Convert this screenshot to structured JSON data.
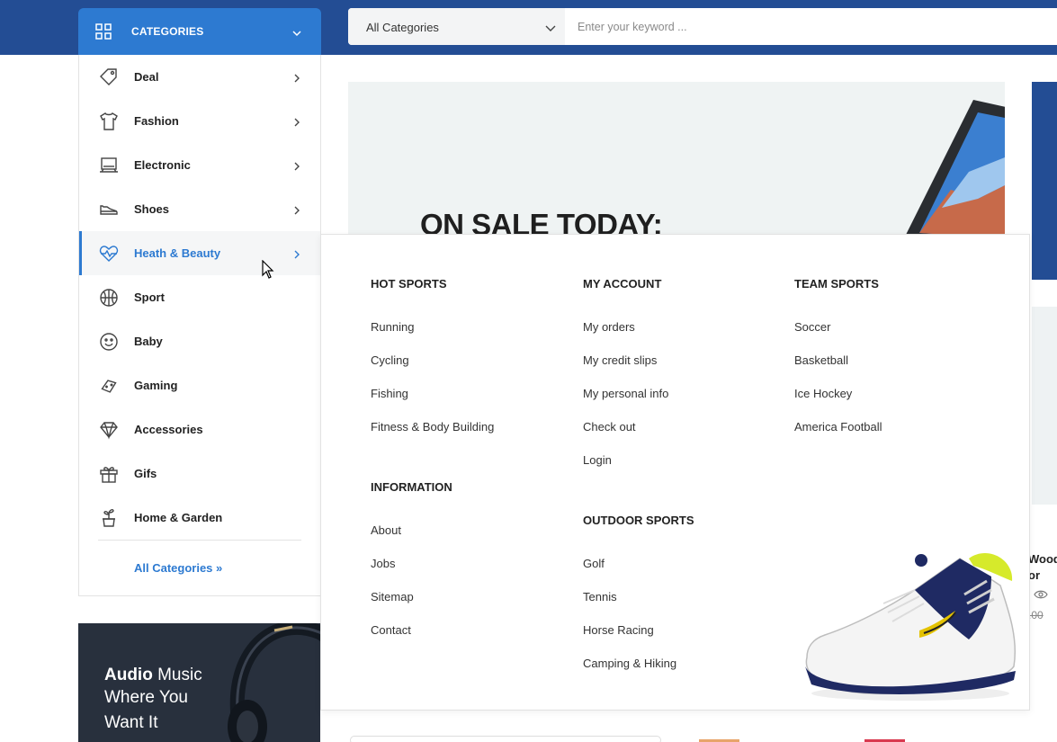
{
  "header": {
    "categories_title": "CATEGORIES",
    "search_category": "All Categories",
    "search_placeholder": "Enter your keyword ..."
  },
  "sidebar": {
    "items": [
      {
        "label": "Deal",
        "icon": "tag-icon"
      },
      {
        "label": "Fashion",
        "icon": "tshirt-icon"
      },
      {
        "label": "Electronic",
        "icon": "laptop-icon"
      },
      {
        "label": "Shoes",
        "icon": "shoe-icon"
      },
      {
        "label": "Heath & Beauty",
        "icon": "heart-pulse-icon",
        "active": true
      },
      {
        "label": "Sport",
        "icon": "basketball-icon"
      },
      {
        "label": "Baby",
        "icon": "smiley-icon"
      },
      {
        "label": "Gaming",
        "icon": "gamepad-icon"
      },
      {
        "label": "Accessories",
        "icon": "diamond-icon"
      },
      {
        "label": "Gifs",
        "icon": "gift-icon"
      },
      {
        "label": "Home & Garden",
        "icon": "plant-icon"
      }
    ],
    "all_categories": "All Categories »"
  },
  "hero": {
    "headline": "ON SALE TODAY:"
  },
  "audio_banner": {
    "bold": "Audio",
    "rest": " Music",
    "line2": "Where You",
    "line3": "Want It"
  },
  "mega_menu": {
    "hot_sports": {
      "title": "HOT SPORTS",
      "links": [
        "Running",
        "Cycling",
        "Fishing",
        "Fitness & Body Building"
      ]
    },
    "information": {
      "title": "INFORMATION",
      "links": [
        "About",
        "Jobs",
        "Sitemap",
        "Contact"
      ]
    },
    "my_account": {
      "title": "MY ACCOUNT",
      "links": [
        "My orders",
        "My credit slips",
        "My personal info",
        "Check out",
        "Login"
      ]
    },
    "outdoor_sports": {
      "title": "OUTDOOR SPORTS",
      "links": [
        "Golf",
        "Tennis",
        "Horse Racing",
        "Camping & Hiking"
      ]
    },
    "team_sports": {
      "title": "TEAM SPORTS",
      "links": [
        "Soccer",
        "Basketball",
        "Ice Hockey",
        "America Football"
      ]
    }
  },
  "peek": {
    "line1": "Wood",
    "line2": "or",
    "price": ".00"
  },
  "colors": {
    "navy": "#234d94",
    "accent": "#2d7ad1",
    "dark_banner": "#28303d"
  }
}
